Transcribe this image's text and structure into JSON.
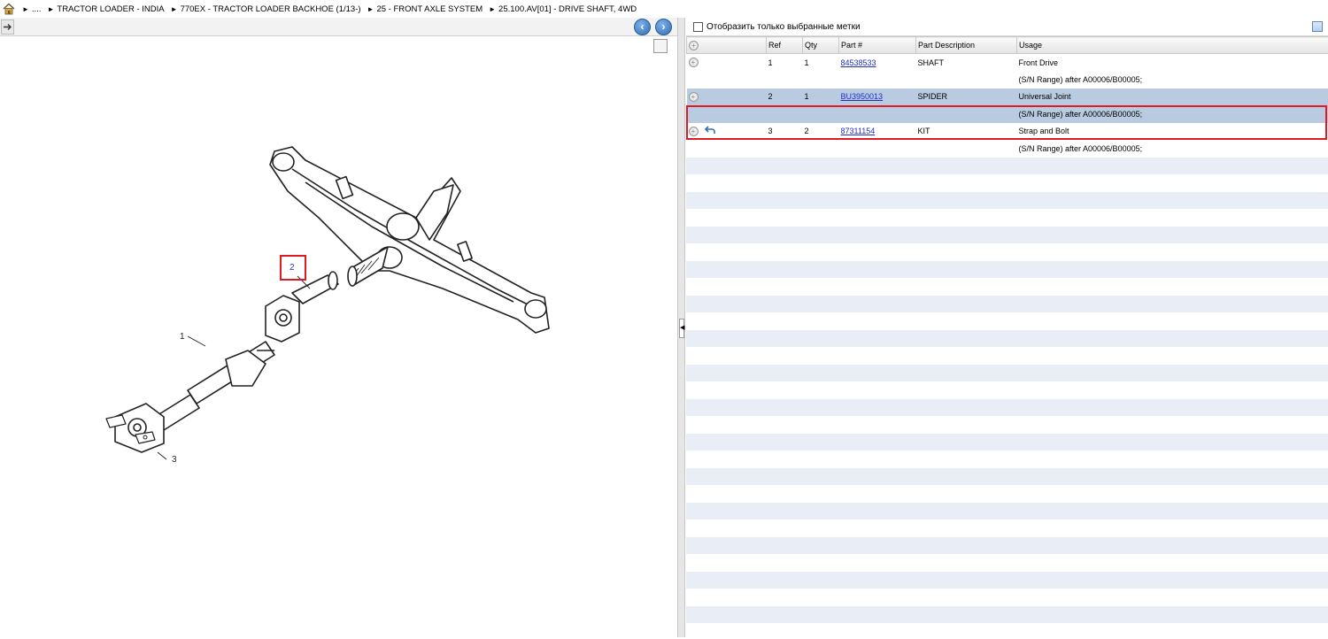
{
  "breadcrumb": {
    "items": [
      "....",
      "TRACTOR LOADER - INDIA",
      "770EX - TRACTOR LOADER BACKHOE (1/13-)",
      "25 - FRONT AXLE SYSTEM",
      "25.100.AV[01] - DRIVE SHAFT, 4WD"
    ]
  },
  "diagram": {
    "callouts": [
      "1",
      "2",
      "3"
    ],
    "highlighted_callout": "2"
  },
  "filter": {
    "label": "Отобразить только выбранные метки",
    "checked": false
  },
  "table": {
    "headers": [
      "Ref",
      "Qty",
      "Part #",
      "Part Description",
      "Usage"
    ],
    "rows": [
      {
        "ref": "1",
        "qty": "1",
        "part": "84538533",
        "desc": "SHAFT",
        "usage": "Front Drive",
        "note": "(S/N Range) after A00006/B00005;",
        "selected": false,
        "has_back_icon": false
      },
      {
        "ref": "2",
        "qty": "1",
        "part": "BU3950013",
        "desc": "SPIDER",
        "usage": "Universal Joint",
        "note": "(S/N Range) after A00006/B00005;",
        "selected": true,
        "has_back_icon": false
      },
      {
        "ref": "3",
        "qty": "2",
        "part": "87311154",
        "desc": "KIT",
        "usage": "Strap and Bolt",
        "note": "(S/N Range) after A00006/B00005;",
        "selected": false,
        "has_back_icon": true
      }
    ]
  },
  "colors": {
    "selection": "#b9cbe0",
    "alternate_row": "#e9eef6",
    "highlight_border": "#e01a22",
    "link": "#1f2fc4"
  },
  "icons": [
    "home-icon",
    "export-icon",
    "back-arrow-icon",
    "forward-arrow-icon",
    "fit-view-icon",
    "add-circle-icon",
    "return-arrow-icon",
    "list-view-icon",
    "collapse-arrow-icon"
  ]
}
